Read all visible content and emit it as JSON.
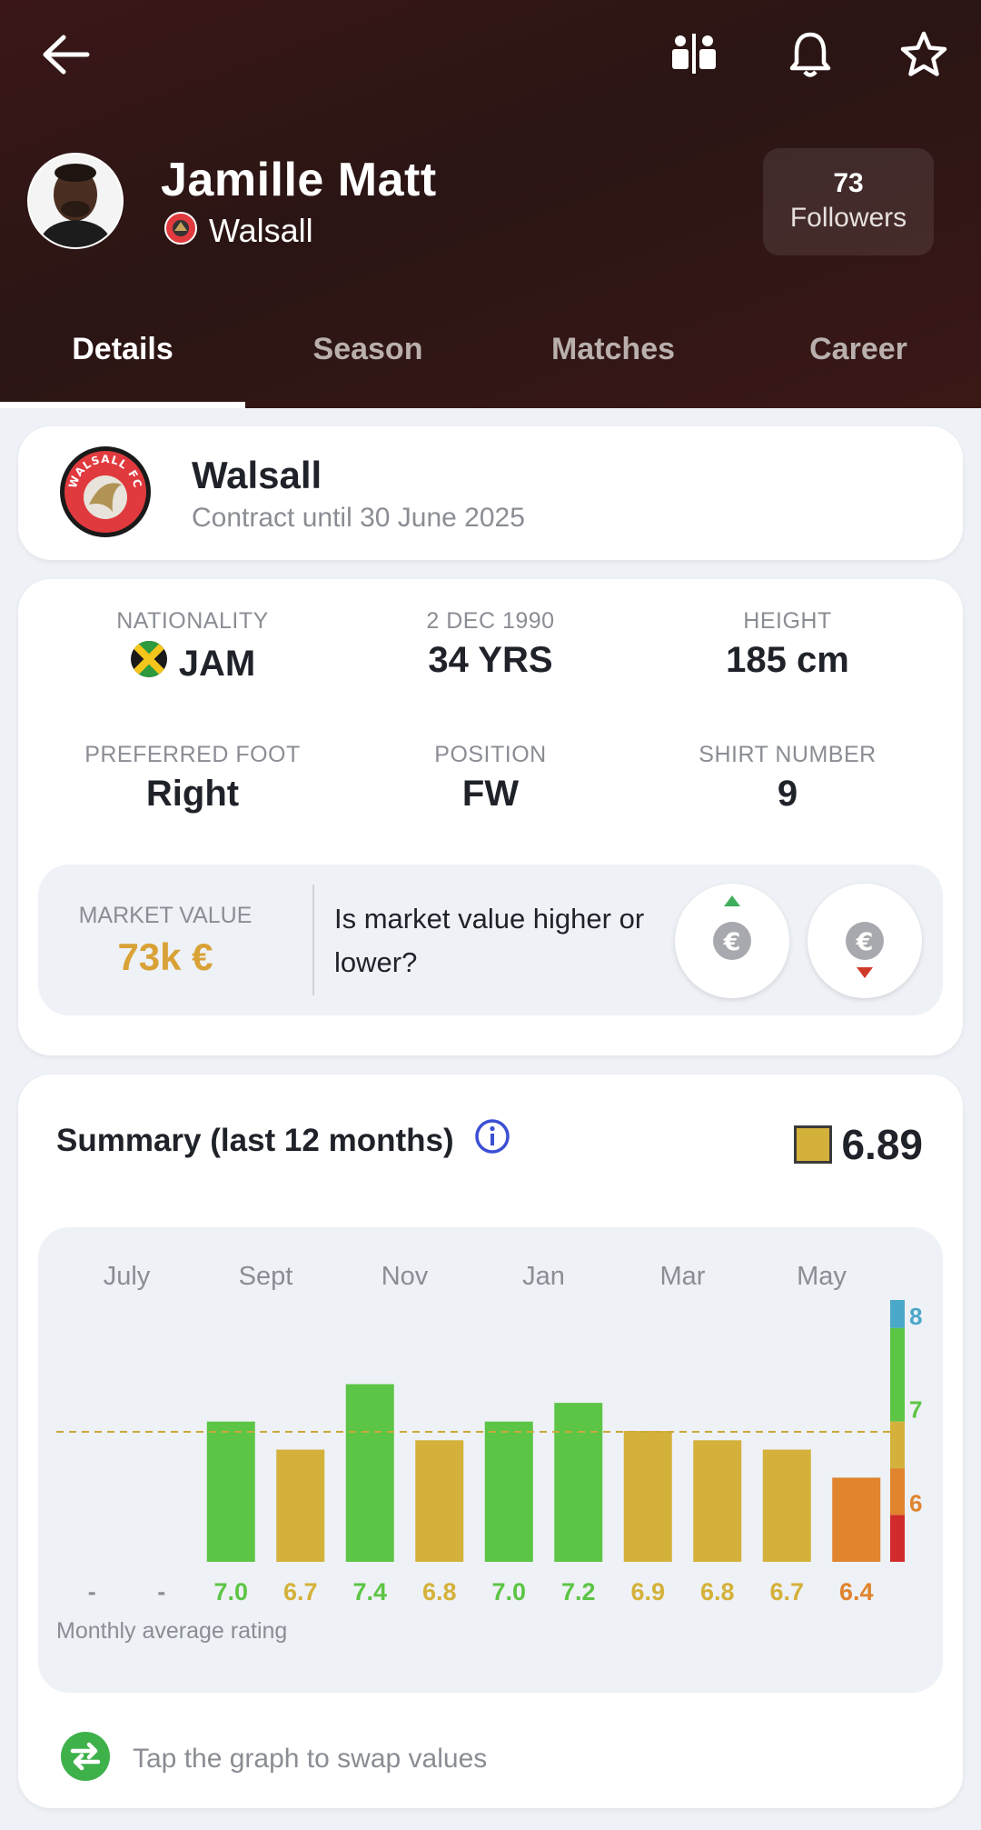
{
  "header": {
    "player_name": "Jamille Matt",
    "club": "Walsall",
    "followers_count": "73",
    "followers_label": "Followers",
    "icons": [
      "back-arrow-icon",
      "compare-icon",
      "bell-icon",
      "star-icon"
    ]
  },
  "tabs": [
    {
      "label": "Details",
      "active": true
    },
    {
      "label": "Season",
      "active": false
    },
    {
      "label": "Matches",
      "active": false
    },
    {
      "label": "Career",
      "active": false
    }
  ],
  "club_card": {
    "crest_text": "WALSALL FC",
    "name": "Walsall",
    "contract": "Contract until 30 June 2025"
  },
  "info": {
    "nationality_label": "NATIONALITY",
    "nationality_value": "JAM",
    "dob_label": "2 DEC 1990",
    "age_value": "34 YRS",
    "height_label": "HEIGHT",
    "height_value": "185 cm",
    "foot_label": "PREFERRED FOOT",
    "foot_value": "Right",
    "position_label": "POSITION",
    "position_value": "FW",
    "shirt_label": "SHIRT NUMBER",
    "shirt_value": "9"
  },
  "market": {
    "label": "MARKET VALUE",
    "value": "73k €",
    "question": "Is market value higher or lower?",
    "currency_symbol": "€"
  },
  "summary": {
    "title": "Summary (last 12 months)",
    "overall_rating": "6.89",
    "caption": "Monthly average rating",
    "swap_hint": "Tap the graph to swap values"
  },
  "colors": {
    "green": "#5cc545",
    "yellow": "#d4b13a",
    "orange": "#e0842e",
    "red": "#d12b2b",
    "blue": "#4aa8c9",
    "accent_market": "#d9a237"
  },
  "chart_data": {
    "type": "bar",
    "month_labels": [
      "July",
      "Sept",
      "Nov",
      "Jan",
      "Mar",
      "May"
    ],
    "values": [
      null,
      null,
      7.0,
      6.7,
      7.4,
      6.8,
      7.0,
      7.2,
      6.9,
      6.8,
      6.7,
      6.4
    ],
    "value_labels": [
      "-",
      "-",
      "7.0",
      "6.7",
      "7.4",
      "6.8",
      "7.0",
      "7.2",
      "6.9",
      "6.8",
      "6.7",
      "6.4"
    ],
    "bar_colors": [
      "",
      "",
      "green",
      "yellow",
      "green",
      "yellow",
      "green",
      "green",
      "yellow",
      "yellow",
      "yellow",
      "orange"
    ],
    "average_line": 6.89,
    "scale_ticks": [
      "8",
      "7",
      "6"
    ],
    "ylim": [
      5.5,
      8.3
    ]
  }
}
